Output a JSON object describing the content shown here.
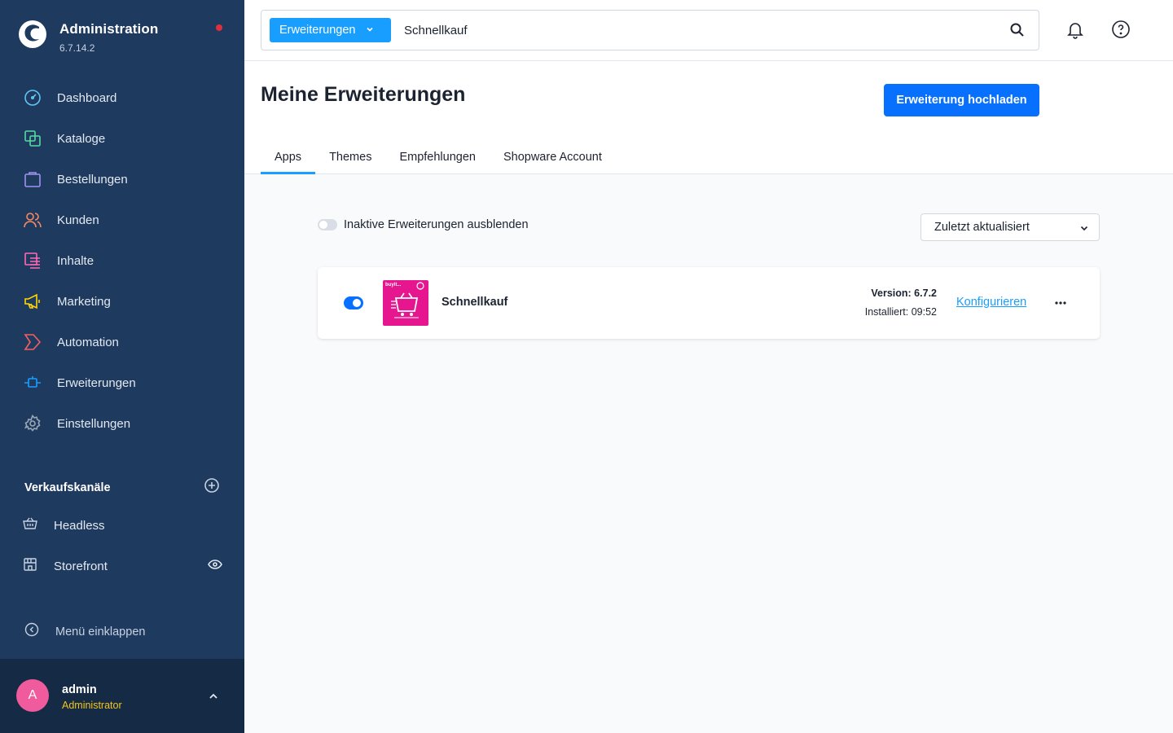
{
  "app": {
    "title": "Administration",
    "version": "6.7.14.2"
  },
  "sidebar": {
    "items": [
      {
        "label": "Dashboard",
        "icon": "dashboard-icon",
        "color": "#60c5f1"
      },
      {
        "label": "Kataloge",
        "icon": "catalog-icon",
        "color": "#57d9a3"
      },
      {
        "label": "Bestellungen",
        "icon": "orders-icon",
        "color": "#a092f0"
      },
      {
        "label": "Kunden",
        "icon": "customers-icon",
        "color": "#f88962"
      },
      {
        "label": "Inhalte",
        "icon": "content-icon",
        "color": "#ff68b4"
      },
      {
        "label": "Marketing",
        "icon": "marketing-icon",
        "color": "#ffd700"
      },
      {
        "label": "Automation",
        "icon": "automation-icon",
        "color": "#f56060"
      },
      {
        "label": "Erweiterungen",
        "icon": "extensions-icon",
        "color": "#189eff"
      },
      {
        "label": "Einstellungen",
        "icon": "settings-icon",
        "color": "#9aa8b5"
      }
    ],
    "sales_channels": {
      "title": "Verkaufskanäle",
      "items": [
        {
          "label": "Headless",
          "icon": "basket-icon"
        },
        {
          "label": "Storefront",
          "icon": "storefront-icon"
        }
      ]
    },
    "collapse_label": "Menü einklappen",
    "user": {
      "initial": "A",
      "name": "admin",
      "role": "Administrator"
    }
  },
  "search": {
    "type_label": "Erweiterungen",
    "value": "Schnellkauf"
  },
  "page": {
    "title": "Meine Erweiterungen",
    "upload_label": "Erweiterung hochladen",
    "tabs": [
      "Apps",
      "Themes",
      "Empfehlungen",
      "Shopware Account"
    ]
  },
  "filters": {
    "hide_inactive_label": "Inaktive Erweiterungen ausblenden",
    "sort_label": "Zuletzt aktualisiert"
  },
  "extensions": [
    {
      "name": "Schnellkauf",
      "active": true,
      "version": "Version: 6.7.2",
      "installed": "Installiert: 09:52",
      "configure_label": "Konfigurieren",
      "logo_text": "buyit..."
    }
  ],
  "colors": {
    "accent": "#189eff",
    "primary": "#0870ff",
    "sidebar": "#1f3a5f"
  }
}
